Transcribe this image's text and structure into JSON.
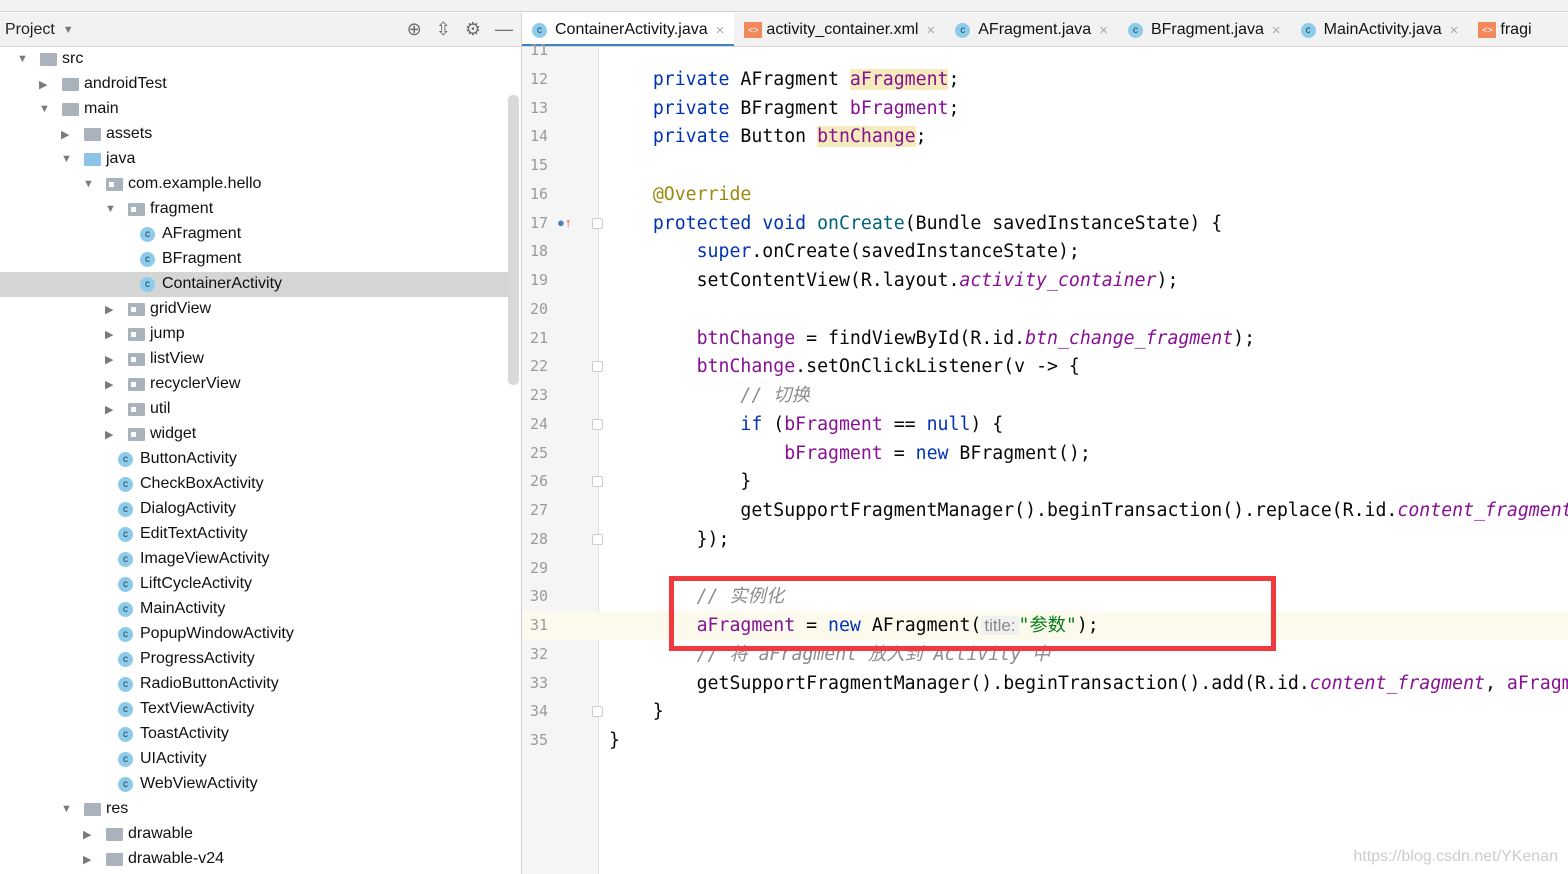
{
  "project_panel": {
    "title": "Project",
    "tools": [
      "locate-icon",
      "collapse-icon",
      "gear-icon",
      "minimize-icon"
    ]
  },
  "tree": [
    {
      "label": "src",
      "level": 0,
      "type": "folder",
      "state": "open"
    },
    {
      "label": "androidTest",
      "level": 1,
      "type": "folder",
      "state": "closed"
    },
    {
      "label": "main",
      "level": 1,
      "type": "folder",
      "state": "open"
    },
    {
      "label": "assets",
      "level": 2,
      "type": "folder",
      "state": "closed"
    },
    {
      "label": "java",
      "level": 2,
      "type": "blue",
      "state": "open"
    },
    {
      "label": "com.example.hello",
      "level": 3,
      "type": "pkg",
      "state": "open"
    },
    {
      "label": "fragment",
      "level": 4,
      "type": "pkg",
      "state": "open"
    },
    {
      "label": "AFragment",
      "level": 5,
      "type": "class"
    },
    {
      "label": "BFragment",
      "level": 5,
      "type": "class"
    },
    {
      "label": "ContainerActivity",
      "level": 5,
      "type": "class",
      "selected": true
    },
    {
      "label": "gridView",
      "level": 4,
      "type": "pkg",
      "state": "closed"
    },
    {
      "label": "jump",
      "level": 4,
      "type": "pkg",
      "state": "closed"
    },
    {
      "label": "listView",
      "level": 4,
      "type": "pkg",
      "state": "closed"
    },
    {
      "label": "recyclerView",
      "level": 4,
      "type": "pkg",
      "state": "closed"
    },
    {
      "label": "util",
      "level": 4,
      "type": "pkg",
      "state": "closed"
    },
    {
      "label": "widget",
      "level": 4,
      "type": "pkg",
      "state": "closed"
    },
    {
      "label": "ButtonActivity",
      "level": 4,
      "type": "class"
    },
    {
      "label": "CheckBoxActivity",
      "level": 4,
      "type": "class"
    },
    {
      "label": "DialogActivity",
      "level": 4,
      "type": "class"
    },
    {
      "label": "EditTextActivity",
      "level": 4,
      "type": "class"
    },
    {
      "label": "ImageViewActivity",
      "level": 4,
      "type": "class"
    },
    {
      "label": "LiftCycleActivity",
      "level": 4,
      "type": "class"
    },
    {
      "label": "MainActivity",
      "level": 4,
      "type": "class"
    },
    {
      "label": "PopupWindowActivity",
      "level": 4,
      "type": "class"
    },
    {
      "label": "ProgressActivity",
      "level": 4,
      "type": "class"
    },
    {
      "label": "RadioButtonActivity",
      "level": 4,
      "type": "class"
    },
    {
      "label": "TextViewActivity",
      "level": 4,
      "type": "class"
    },
    {
      "label": "ToastActivity",
      "level": 4,
      "type": "class"
    },
    {
      "label": "UIActivity",
      "level": 4,
      "type": "class"
    },
    {
      "label": "WebViewActivity",
      "level": 4,
      "type": "class"
    },
    {
      "label": "res",
      "level": 2,
      "type": "folder",
      "state": "open"
    },
    {
      "label": "drawable",
      "level": 3,
      "type": "folder",
      "state": "closed"
    },
    {
      "label": "drawable-v24",
      "level": 3,
      "type": "folder",
      "state": "closed"
    }
  ],
  "tabs": [
    {
      "label": "ContainerActivity.java",
      "icon": "class",
      "active": true
    },
    {
      "label": "activity_container.xml",
      "icon": "xml"
    },
    {
      "label": "AFragment.java",
      "icon": "class"
    },
    {
      "label": "BFragment.java",
      "icon": "class"
    },
    {
      "label": "MainActivity.java",
      "icon": "class"
    },
    {
      "label": "fragi",
      "icon": "xml"
    }
  ],
  "editor": {
    "current_line": 31,
    "lines": [
      {
        "n": 11,
        "t": []
      },
      {
        "n": 12,
        "t": [
          [
            "    "
          ],
          [
            "private",
            "k"
          ],
          [
            " AFragment "
          ],
          [
            "aFragment",
            "f hl"
          ],
          [
            ";"
          ]
        ]
      },
      {
        "n": 13,
        "t": [
          [
            "    "
          ],
          [
            "private",
            "k"
          ],
          [
            " BFragment "
          ],
          [
            "bFragment",
            "f"
          ],
          [
            ";"
          ]
        ]
      },
      {
        "n": 14,
        "t": [
          [
            "    "
          ],
          [
            "private",
            "k"
          ],
          [
            " Button "
          ],
          [
            "btnChange",
            "f hl"
          ],
          [
            ";"
          ]
        ]
      },
      {
        "n": 15,
        "t": []
      },
      {
        "n": 16,
        "t": [
          [
            "    "
          ],
          [
            "@Override",
            "a"
          ]
        ]
      },
      {
        "n": 17,
        "t": [
          [
            "    "
          ],
          [
            "protected",
            "k"
          ],
          [
            " "
          ],
          [
            "void",
            "k"
          ],
          [
            " "
          ],
          [
            "onCreate",
            "m"
          ],
          [
            "(Bundle savedInstanceState) {"
          ]
        ]
      },
      {
        "n": 18,
        "t": [
          [
            "        "
          ],
          [
            "super",
            "k"
          ],
          [
            ".onCreate(savedInstanceState);"
          ]
        ]
      },
      {
        "n": 19,
        "t": [
          [
            "        setContentView(R.layout."
          ],
          [
            "activity_container",
            "i"
          ],
          [
            ");"
          ]
        ]
      },
      {
        "n": 20,
        "t": []
      },
      {
        "n": 21,
        "t": [
          [
            "        "
          ],
          [
            "btnChange",
            "f"
          ],
          [
            " = findViewById(R.id."
          ],
          [
            "btn_change_fragment",
            "i"
          ],
          [
            ");"
          ]
        ]
      },
      {
        "n": 22,
        "t": [
          [
            "        "
          ],
          [
            "btnChange",
            "f"
          ],
          [
            ".setOnClickListener(v -> {"
          ]
        ]
      },
      {
        "n": 23,
        "t": [
          [
            "            "
          ],
          [
            "// 切换",
            "cm"
          ]
        ]
      },
      {
        "n": 24,
        "t": [
          [
            "            "
          ],
          [
            "if",
            "k"
          ],
          [
            " ("
          ],
          [
            "bFragment",
            "f"
          ],
          [
            " == "
          ],
          [
            "null",
            "k"
          ],
          [
            ") {"
          ]
        ]
      },
      {
        "n": 25,
        "t": [
          [
            "                "
          ],
          [
            "bFragment",
            "f"
          ],
          [
            " = "
          ],
          [
            "new",
            "k"
          ],
          [
            " BFragment();"
          ]
        ]
      },
      {
        "n": 26,
        "t": [
          [
            "            }"
          ]
        ]
      },
      {
        "n": 27,
        "t": [
          [
            "            getSupportFragmentManager().beginTransaction().replace(R.id."
          ],
          [
            "content_fragment",
            "i"
          ]
        ]
      },
      {
        "n": 28,
        "t": [
          [
            "        });"
          ]
        ]
      },
      {
        "n": 29,
        "t": []
      },
      {
        "n": 30,
        "t": [
          [
            "        "
          ],
          [
            "// 实例化",
            "cm"
          ]
        ]
      },
      {
        "n": 31,
        "t": [
          [
            "        "
          ],
          [
            "aFragment",
            "f"
          ],
          [
            " = "
          ],
          [
            "new",
            "k"
          ],
          [
            " AFragment("
          ],
          [
            "title:",
            "hint"
          ],
          [
            ""
          ],
          [
            "\"参数\"",
            "s"
          ],
          [
            ");"
          ]
        ]
      },
      {
        "n": 32,
        "t": [
          [
            "        "
          ],
          [
            "// 将 aFragment 放入到 Activity 中",
            "cm"
          ]
        ]
      },
      {
        "n": 33,
        "t": [
          [
            "        getSupportFragmentManager().beginTransaction().add(R.id."
          ],
          [
            "content_fragment",
            "i"
          ],
          [
            ", "
          ],
          [
            "aFragment",
            "f"
          ]
        ]
      },
      {
        "n": 34,
        "t": [
          [
            "    }"
          ]
        ]
      },
      {
        "n": 35,
        "t": [
          [
            "}"
          ]
        ]
      }
    ]
  },
  "watermark": "https://blog.csdn.net/YKenan",
  "colors": {
    "annotation_box": "#f03a3d",
    "tab_underline": "#4083c9",
    "keyword": "#0033b3",
    "field": "#871094"
  }
}
